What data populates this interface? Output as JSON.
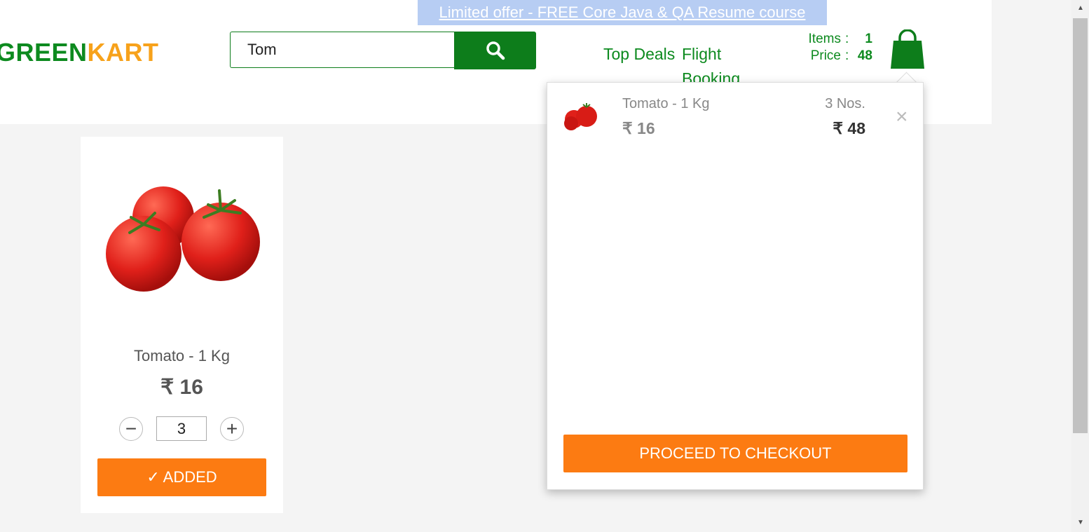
{
  "promo": {
    "text": "Limited offer - FREE Core Java & QA Resume course"
  },
  "logo": {
    "part1": "GREEN",
    "part2": "KART"
  },
  "search": {
    "value": "Tom"
  },
  "nav": {
    "top_deals": "Top Deals",
    "flight_booking": "Flight Booking"
  },
  "cart_summary": {
    "items_label": "Items",
    "items_value": "1",
    "price_label": "Price",
    "price_value": "48",
    "separator": ":"
  },
  "product": {
    "name": "Tomato - 1 Kg",
    "price": "₹ 16",
    "quantity": "3",
    "decrement_symbol": "−",
    "increment_symbol": "+",
    "button_label": "✓ ADDED"
  },
  "cart_preview": {
    "item_name": "Tomato - 1 Kg",
    "item_price": "₹ 16",
    "item_qty": "3 Nos.",
    "item_amount": "₹ 48",
    "remove_symbol": "×",
    "checkout_label": "PROCEED TO CHECKOUT"
  },
  "colors": {
    "brand_green": "#0d8a1f",
    "brand_orange": "#f7a21b",
    "button_orange": "#fc7b12",
    "promo_bg": "#b7cdf3"
  },
  "icons": [
    "search-icon",
    "cart-icon",
    "tomato-image",
    "close-icon"
  ]
}
